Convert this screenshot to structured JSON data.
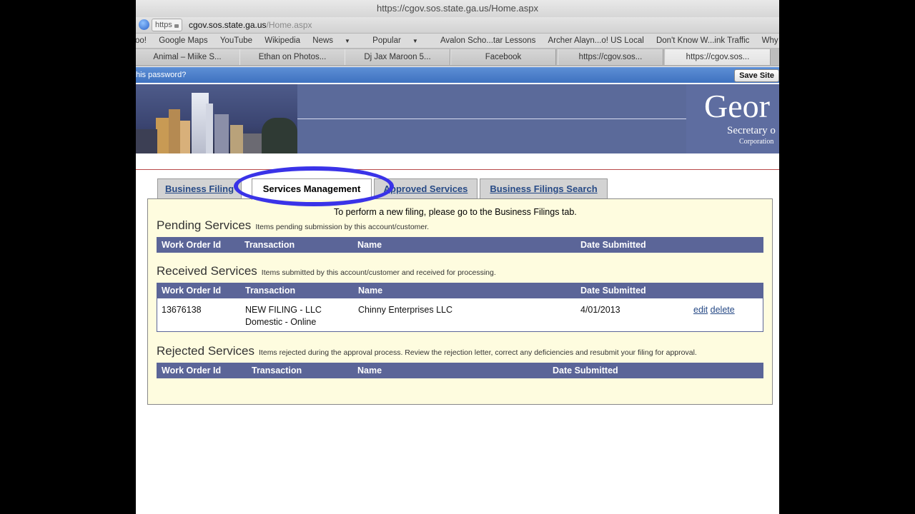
{
  "browser": {
    "window_title": "https://cgov.sos.state.ga.us/Home.aspx",
    "url_badge": "https",
    "url_host": "cgov.sos.state.ga.us",
    "url_path": "/Home.aspx",
    "bookmarks": [
      "oo!",
      "Google Maps",
      "YouTube",
      "Wikipedia",
      "News",
      "Popular",
      "Avalon Scho...tar Lessons",
      "Archer Alayn...o! US Local",
      "Don't Know W...ink Traffic",
      "Why Baske"
    ],
    "tabs": [
      "Animal – Miike S...",
      "Ethan on Photos...",
      "Dj Jax Maroon 5...",
      "Facebook",
      "https://cgov.sos...",
      "https://cgov.sos..."
    ],
    "password_prompt": "his password?",
    "save_site_label": "Save Site"
  },
  "header": {
    "title": "Geor",
    "secretary": "Secretary o",
    "division": "Corporation"
  },
  "app_tabs": [
    "Business Filing",
    "Services Management",
    "Approved Services",
    "Business Filings Search"
  ],
  "notice": "To perform a new filing, please go to the Business Filings tab.",
  "columns": {
    "work_order": "Work Order Id",
    "transaction": "Transaction",
    "name": "Name",
    "date": "Date Submitted"
  },
  "pending": {
    "title": "Pending Services",
    "subtitle": "Items pending submission by this account/customer."
  },
  "received": {
    "title": "Received Services",
    "subtitle": "Items submitted by this account/customer and received for processing.",
    "rows": [
      {
        "work_order": "13676138",
        "transaction_line1": "NEW FILING - LLC",
        "transaction_line2": "Domestic - Online",
        "name": "Chinny Enterprises LLC",
        "date": "4/01/2013",
        "edit": "edit",
        "delete": "delete"
      }
    ]
  },
  "rejected": {
    "title": "Rejected Services",
    "subtitle": "Items rejected during the approval process. Review the rejection letter, correct any deficiencies and resubmit your filing for approval."
  },
  "colors": {
    "accent_ring": "#3a33e8",
    "table_header": "#5b6598",
    "panel_bg": "#fefcdf",
    "link": "#274a86"
  }
}
